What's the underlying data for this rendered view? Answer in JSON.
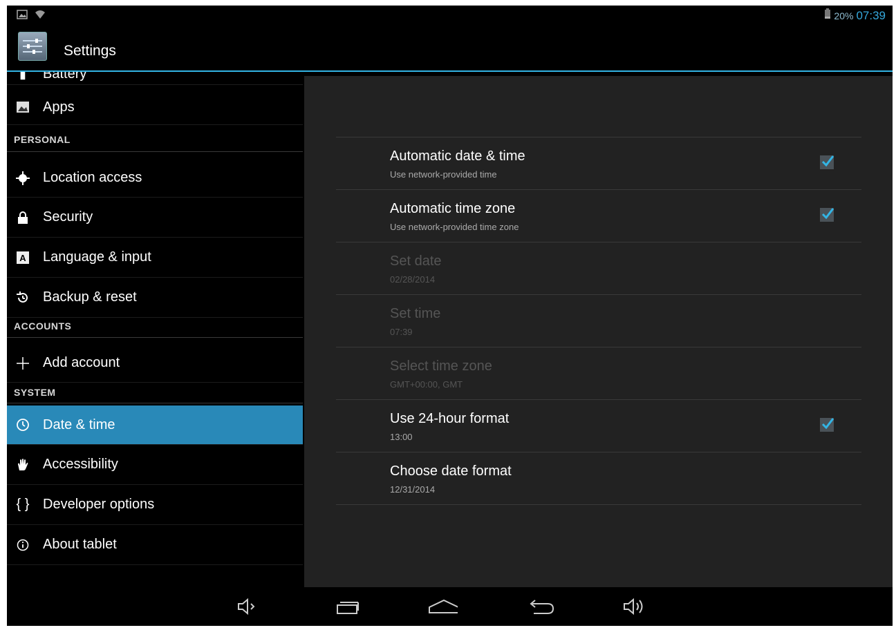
{
  "status": {
    "battery_percent": "20%",
    "time": "07:39"
  },
  "app": {
    "title": "Settings"
  },
  "sidebar": {
    "top_partial": "Battery",
    "apps": "Apps",
    "sections": {
      "personal": "PERSONAL",
      "accounts": "ACCOUNTS",
      "system": "SYSTEM"
    },
    "items": {
      "location": "Location access",
      "security": "Security",
      "language": "Language & input",
      "backup": "Backup & reset",
      "add_account": "Add account",
      "date_time": "Date & time",
      "accessibility": "Accessibility",
      "developer": "Developer options",
      "about": "About tablet"
    }
  },
  "prefs": {
    "auto_date": {
      "title": "Automatic date & time",
      "summary": "Use network-provided time",
      "checked": true
    },
    "auto_zone": {
      "title": "Automatic time zone",
      "summary": "Use network-provided time zone",
      "checked": true
    },
    "set_date": {
      "title": "Set date",
      "summary": "02/28/2014"
    },
    "set_time": {
      "title": "Set time",
      "summary": "07:39"
    },
    "select_zone": {
      "title": "Select time zone",
      "summary": "GMT+00:00, GMT"
    },
    "h24": {
      "title": "Use 24-hour format",
      "summary": "13:00",
      "checked": true
    },
    "date_format": {
      "title": "Choose date format",
      "summary": "12/31/2014"
    }
  },
  "colors": {
    "accent": "#33b5e5",
    "selected": "#2989b8",
    "panel": "#222222"
  }
}
